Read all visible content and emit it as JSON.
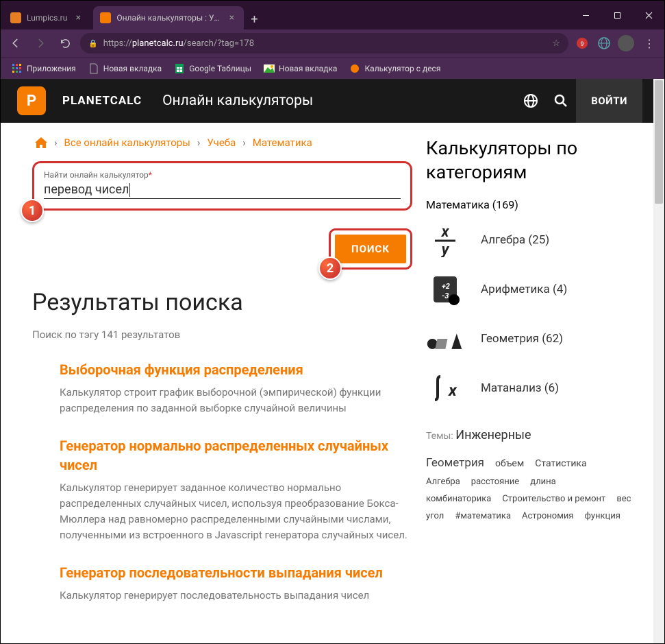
{
  "browser": {
    "tabs": [
      {
        "title": "Lumpics.ru",
        "active": false
      },
      {
        "title": "Онлайн калькуляторы : Учеба :",
        "active": true
      }
    ],
    "url_prefix": "https://",
    "url_host": "planetcalc.ru",
    "url_path": "/search/?tag=178",
    "bookmarks": [
      {
        "label": "Приложения",
        "ico": "apps"
      },
      {
        "label": "Новая вкладка",
        "ico": "doc"
      },
      {
        "label": "Google Таблицы",
        "ico": "sheets"
      },
      {
        "label": "Новая вкладка",
        "ico": "img"
      },
      {
        "label": "Калькулятор с деся",
        "ico": "calc"
      }
    ]
  },
  "header": {
    "logo_letter": "P",
    "brand": "PLANETCALC",
    "subtitle": "Онлайн калькуляторы",
    "login": "ВОЙТИ"
  },
  "breadcrumbs": [
    "Все онлайн калькуляторы",
    "Учеба",
    "Математика"
  ],
  "search": {
    "label": "Найти онлайн калькулятор",
    "value": "перевод чисел",
    "button": "ПОИСК"
  },
  "badges": {
    "one": "1",
    "two": "2"
  },
  "results": {
    "title": "Результаты поиска",
    "subtitle": "Поиск по тэгу 141 результатов",
    "items": [
      {
        "title": "Выборочная функция распределения",
        "desc": "Калькулятор строит график выборочной (эмпирической) функции распределения по заданной выборке случайной величины"
      },
      {
        "title": "Генератор нормально распределенных случайных чисел",
        "desc": "Калькулятор генерирует заданное количество нормально распределенных случайных чисел, используя преобразование Бокса-Мюллера над равномерно распределенными случайными числами, полученными из встроенного в Javascript генератора случайных чисел."
      },
      {
        "title": "Генератор последовательности выпадания чисел",
        "desc": "Калькулятор генерирует последовательность выпадания чисел"
      }
    ]
  },
  "sidebar": {
    "title": "Калькуляторы по категориям",
    "top_cat": "Математика (169)",
    "cats": [
      {
        "label": "Алгебра (25)",
        "icon": "xy"
      },
      {
        "label": "Арифметика (4)",
        "icon": "arith"
      },
      {
        "label": "Геометрия (62)",
        "icon": "geom"
      },
      {
        "label": "Матанализ (6)",
        "icon": "integral"
      }
    ],
    "theme_label": "Темы:",
    "theme_main": "Инженерные",
    "tags": [
      {
        "text": "Геометрия",
        "size": "l"
      },
      {
        "text": "объем",
        "size": "m"
      },
      {
        "text": "Статистика",
        "size": "m"
      },
      {
        "text": "Алгебра",
        "size": "s"
      },
      {
        "text": "расстояние",
        "size": "s"
      },
      {
        "text": "длина",
        "size": "s"
      },
      {
        "text": "комбинаторика",
        "size": "s"
      },
      {
        "text": "Строительство и ремонт",
        "size": "s"
      },
      {
        "text": "вес",
        "size": "s"
      },
      {
        "text": "угол",
        "size": "s"
      },
      {
        "text": "#математика",
        "size": "s"
      },
      {
        "text": "Астрономия",
        "size": "s"
      },
      {
        "text": "функция",
        "size": "s"
      }
    ]
  }
}
